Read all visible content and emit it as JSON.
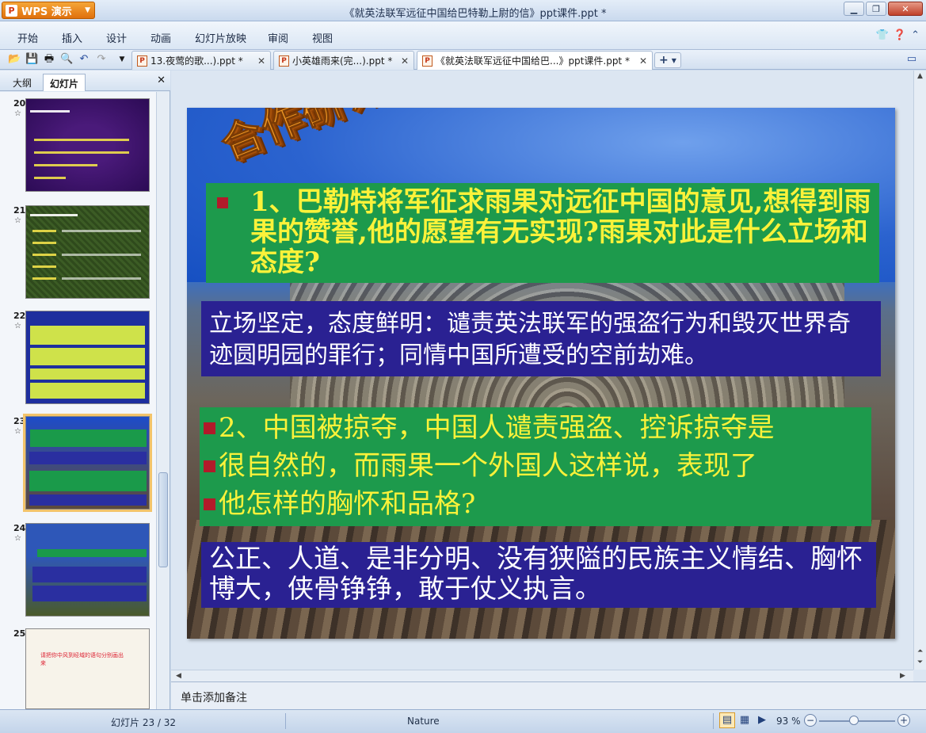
{
  "app": {
    "name": "WPS 演示",
    "window_title": "《就英法联军远征中国给巴特勒上尉的信》ppt课件.ppt *"
  },
  "menu": [
    "开始",
    "插入",
    "设计",
    "动画",
    "幻灯片放映",
    "审阅",
    "视图"
  ],
  "tabs": [
    {
      "label": "13.夜莺的歌...).ppt *"
    },
    {
      "label": "小英雄雨来(完...).ppt *"
    },
    {
      "label": "《就英法联军远征中国给巴...》ppt课件.ppt *"
    }
  ],
  "panel": {
    "tab_outline": "大纲",
    "tab_slides": "幻灯片"
  },
  "thumbnails": [
    {
      "num": "20"
    },
    {
      "num": "21"
    },
    {
      "num": "22"
    },
    {
      "num": "23"
    },
    {
      "num": "24"
    },
    {
      "num": "25"
    }
  ],
  "thumb25_text": "请把你中风到经域的语句分别画出来",
  "slide": {
    "wordart": "合作研讨",
    "q1": "1、巴勒特将军征求雨果对远征中国的意见,想得到雨果的赞誉,他的愿望有无实现?雨果对此是什么立场和态度?",
    "a1": "立场坚定，态度鲜明：谴责英法联军的强盗行为和毁灭世界奇迹圆明园的罪行；同情中国所遭受的空前劫难。",
    "q2_lines": [
      "2、中国被掠夺，中国人谴责强盗、控诉掠夺是",
      "很自然的，而雨果一个外国人这样说，表现了",
      "他怎样的胸怀和品格?"
    ],
    "a2": "公正、人道、是非分明、没有狭隘的民族主义情结、胸怀博大，侠骨铮铮，敢于仗义执言。"
  },
  "notes_placeholder": "单击添加备注",
  "status": {
    "slide_count": "幻灯片 23 / 32",
    "theme": "Nature",
    "zoom": "93 %"
  },
  "zoom_level": 0.4
}
